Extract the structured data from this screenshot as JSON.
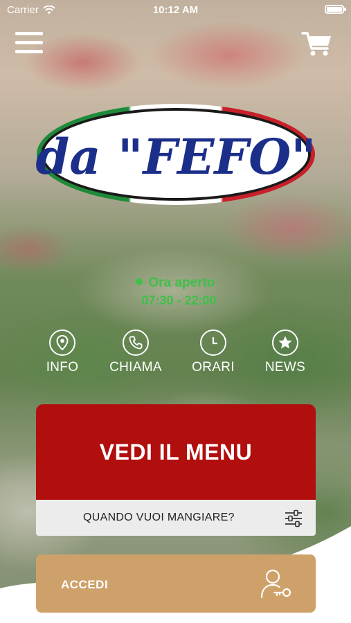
{
  "status_bar": {
    "carrier": "Carrier",
    "time": "10:12 AM"
  },
  "header": {
    "menu_icon": "hamburger-icon",
    "cart_icon": "cart-icon"
  },
  "logo": {
    "text": "da \"FEFO\"",
    "colors": {
      "text": "#1b2f8a",
      "flag_green": "#1e8b3a",
      "flag_red": "#c8202a"
    }
  },
  "opening": {
    "status": "Ora aperto",
    "hours": "07:30 - 22:00",
    "color": "#3fc04a"
  },
  "actions": [
    {
      "label": "INFO",
      "icon": "location-pin-icon"
    },
    {
      "label": "CHIAMA",
      "icon": "phone-icon"
    },
    {
      "label": "ORARI",
      "icon": "clock-icon"
    },
    {
      "label": "NEWS",
      "icon": "star-icon"
    }
  ],
  "menu_card": {
    "title": "VEDI IL MENU",
    "color": "#b10e0e"
  },
  "when_bar": {
    "label": "QUANDO VUOI MANGIARE?",
    "icon": "filter-sliders-icon"
  },
  "login": {
    "label": "ACCEDI",
    "icon": "user-key-icon",
    "color": "#cfa16a"
  }
}
